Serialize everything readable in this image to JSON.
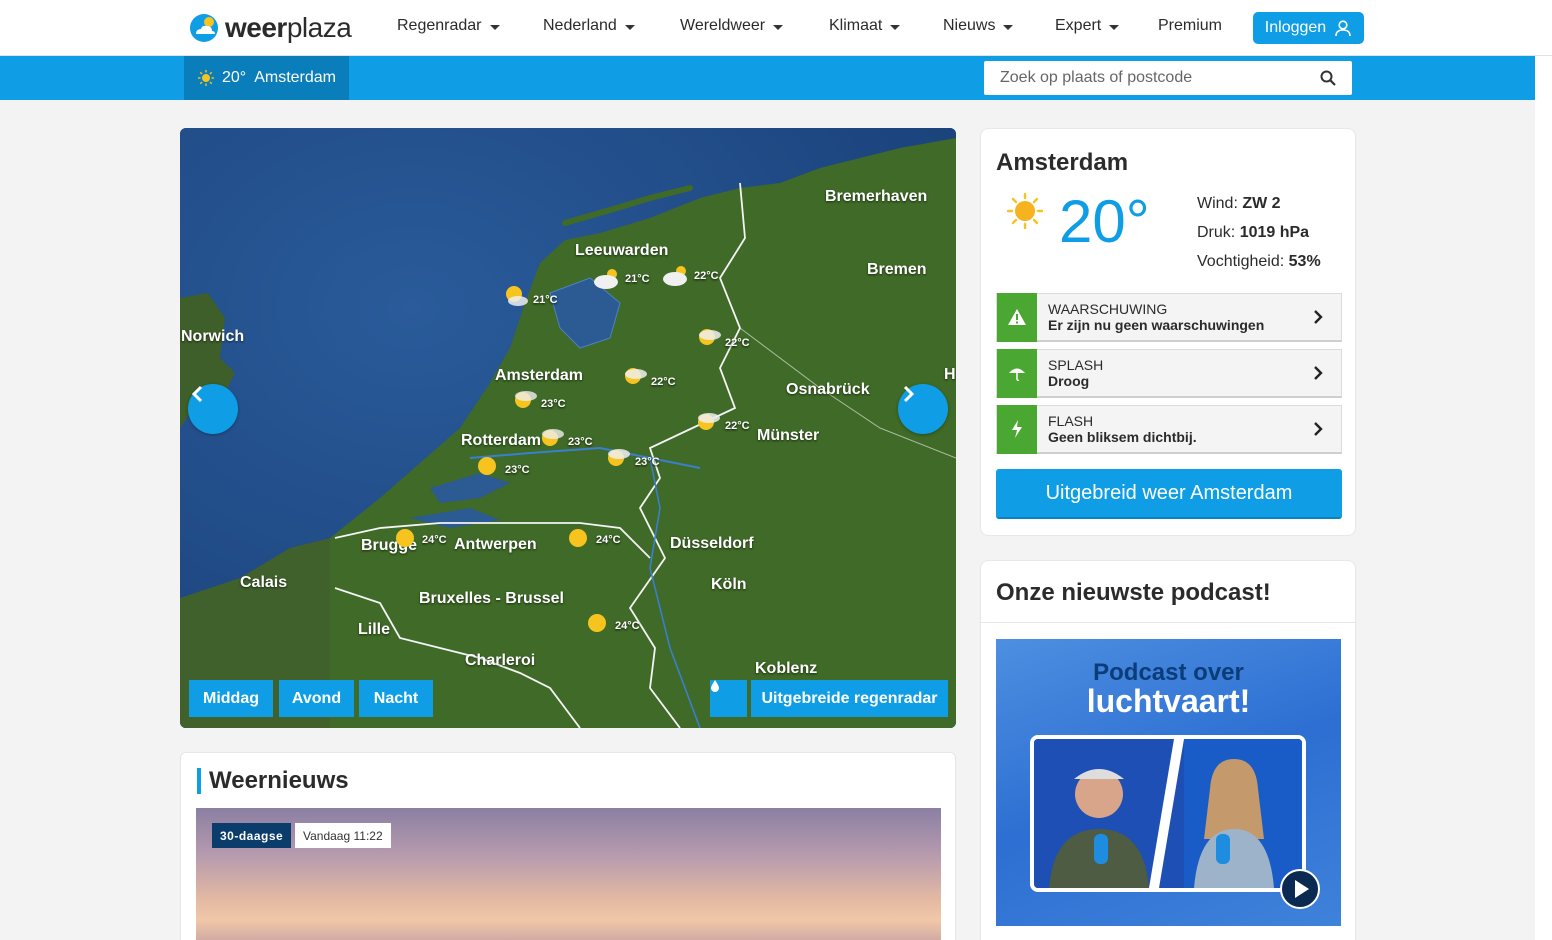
{
  "brand": {
    "logo_text_bold": "weer",
    "logo_text_light": "plaza"
  },
  "nav": {
    "items": [
      {
        "label": "Regenradar",
        "has_dropdown": true
      },
      {
        "label": "Nederland",
        "has_dropdown": true
      },
      {
        "label": "Wereldweer",
        "has_dropdown": true
      },
      {
        "label": "Klimaat",
        "has_dropdown": true
      },
      {
        "label": "Nieuws",
        "has_dropdown": true
      },
      {
        "label": "Expert",
        "has_dropdown": true
      },
      {
        "label": "Premium",
        "has_dropdown": false
      }
    ],
    "login_label": "Inloggen"
  },
  "location_bar": {
    "temperature": "20°",
    "city": "Amsterdam",
    "search_placeholder": "Zoek op plaats of postcode"
  },
  "map": {
    "cities": [
      "Bremerhaven",
      "Leeuwarden",
      "Bremen",
      "Norwich",
      "Amsterdam",
      "Osnabrück",
      "H",
      "Münster",
      "Rotterdam",
      "Düsseldorf",
      "Brugge",
      "Antwerpen",
      "Calais",
      "Köln",
      "Bruxelles - Brussel",
      "Lille",
      "Charleroi",
      "Koblenz"
    ],
    "temperatures": [
      "21°C",
      "22°C",
      "21°C",
      "22°C",
      "22°C",
      "23°C",
      "22°C",
      "23°C",
      "23°C",
      "23°C",
      "24°C",
      "24°C",
      "24°C"
    ],
    "buttons": {
      "midday": "Middag",
      "evening": "Avond",
      "night": "Nacht",
      "radar": "Uitgebreide regenradar"
    }
  },
  "current": {
    "city": "Amsterdam",
    "temperature": "20°",
    "wind_label": "Wind:",
    "wind_value": "ZW 2",
    "pressure_label": "Druk:",
    "pressure_value": "1019 hPa",
    "humidity_label": "Vochtigheid:",
    "humidity_value": "53%",
    "alerts": [
      {
        "title": "WAARSCHUWING",
        "text": "Er zijn nu geen waarschuwingen"
      },
      {
        "title": "SPLASH",
        "text": "Droog"
      },
      {
        "title": "FLASH",
        "text": "Geen bliksem dichtbij."
      }
    ],
    "cta": "Uitgebreid weer Amsterdam"
  },
  "podcast": {
    "title": "Onze nieuwste podcast!",
    "headline_top": "Podcast over",
    "headline_bottom": "luchtvaart!"
  },
  "news": {
    "title": "Weernieuws",
    "tag": "30-daagse",
    "time": "Vandaag 11:22"
  },
  "colors": {
    "accent": "#0f9ee5",
    "alert_green": "#4aa731",
    "loc_pill": "#0a7dbb"
  }
}
